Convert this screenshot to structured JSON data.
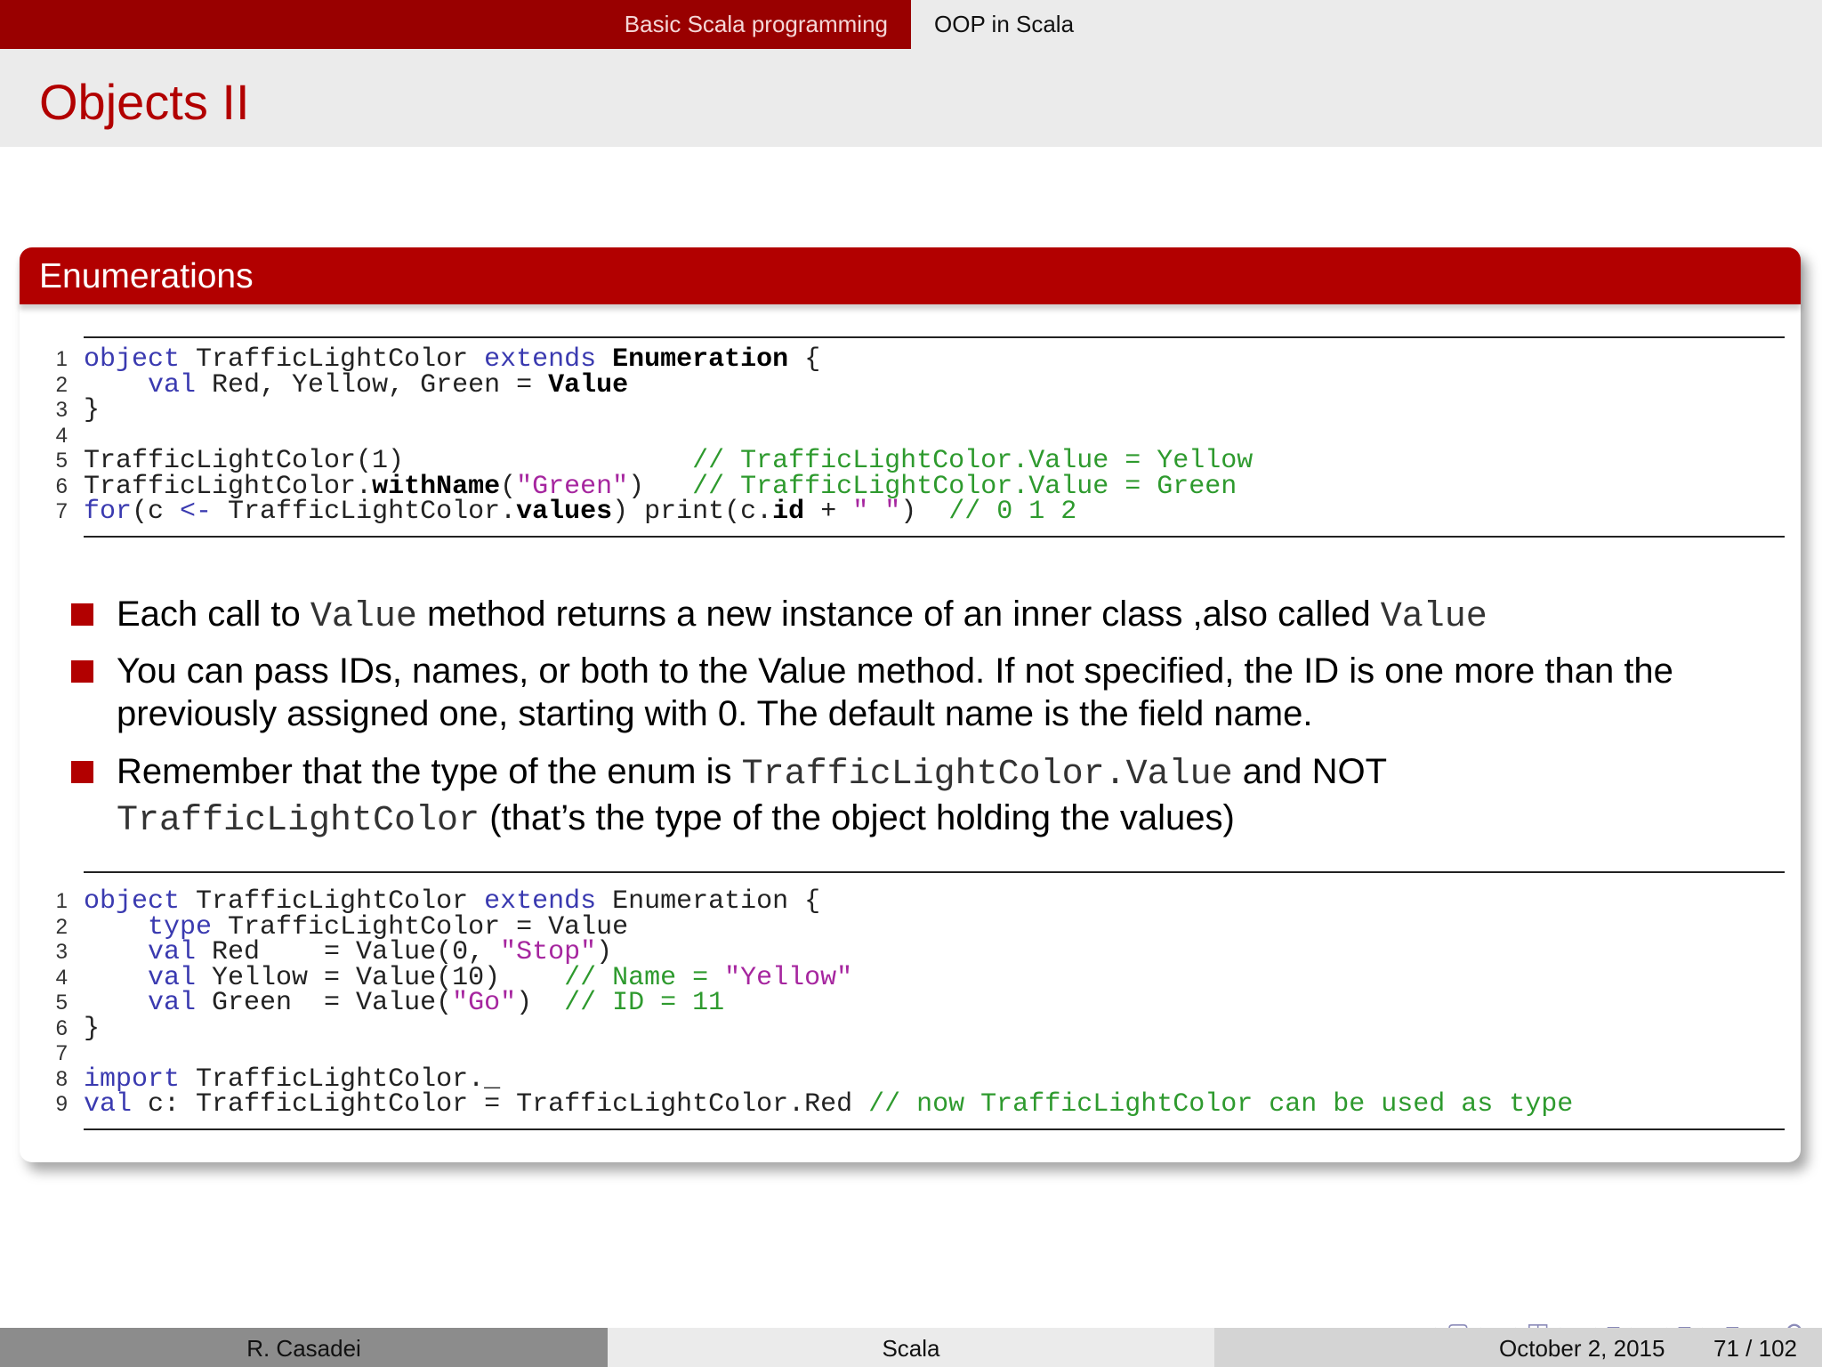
{
  "nav": {
    "section": "Basic Scala programming",
    "subsection": "OOP in Scala"
  },
  "frame_title": "Objects II",
  "block_title": "Enumerations",
  "listing1": [
    {
      "n": "1",
      "parts": [
        [
          "kw",
          "object"
        ],
        [
          "",
          " TrafficLightColor "
        ],
        [
          "kw",
          "extends"
        ],
        [
          "",
          " "
        ],
        [
          "bd",
          "Enumeration"
        ],
        [
          "",
          " {"
        ]
      ]
    },
    {
      "n": "2",
      "parts": [
        [
          "",
          "    "
        ],
        [
          "kw",
          "val"
        ],
        [
          "",
          " Red, Yellow, Green = "
        ],
        [
          "bd",
          "Value"
        ]
      ]
    },
    {
      "n": "3",
      "parts": [
        [
          "",
          "}"
        ]
      ]
    },
    {
      "n": "4",
      "parts": [
        [
          "",
          ""
        ]
      ]
    },
    {
      "n": "5",
      "parts": [
        [
          "",
          "TrafficLightColor(1)                  "
        ],
        [
          "cm",
          "// TrafficLightColor.Value = Yellow"
        ]
      ]
    },
    {
      "n": "6",
      "parts": [
        [
          "",
          "TrafficLightColor."
        ],
        [
          "bd",
          "withName"
        ],
        [
          "",
          "("
        ],
        [
          "st",
          "\"Green\""
        ],
        [
          "",
          ")   "
        ],
        [
          "cm",
          "// TrafficLightColor.Value = Green"
        ]
      ]
    },
    {
      "n": "7",
      "parts": [
        [
          "kw",
          "for"
        ],
        [
          "",
          "(c "
        ],
        [
          "kw",
          "<-"
        ],
        [
          "",
          " TrafficLightColor."
        ],
        [
          "bd",
          "values"
        ],
        [
          "",
          ") print(c."
        ],
        [
          "bd",
          "id"
        ],
        [
          "",
          " + "
        ],
        [
          "st",
          "\" \""
        ],
        [
          "",
          ")  "
        ],
        [
          "cm",
          "// 0 1 2"
        ]
      ]
    }
  ],
  "bullets": [
    [
      [
        "t",
        "Each call to "
      ],
      [
        "c",
        "Value"
      ],
      [
        "t",
        " method returns a new instance of an inner class ,also called "
      ],
      [
        "c",
        "Value"
      ]
    ],
    [
      [
        "t",
        "You can pass IDs, names, or both to the Value method. If not specified, the ID is one more than the"
      ],
      [
        "br",
        ""
      ],
      [
        "t",
        "previously assigned one, starting with 0. The default name is the field name."
      ]
    ],
    [
      [
        "t",
        "Remember that the type of the enum is "
      ],
      [
        "c",
        "TrafficLightColor.Value"
      ],
      [
        "t",
        " and NOT"
      ],
      [
        "br",
        ""
      ],
      [
        "c",
        "TrafficLightColor"
      ],
      [
        "t",
        " (that’s the type of the object holding the values)"
      ]
    ]
  ],
  "listing2": [
    {
      "n": "1",
      "parts": [
        [
          "kw",
          "object"
        ],
        [
          "",
          " TrafficLightColor "
        ],
        [
          "kw",
          "extends"
        ],
        [
          "",
          " Enumeration {"
        ]
      ]
    },
    {
      "n": "2",
      "parts": [
        [
          "",
          "    "
        ],
        [
          "kw",
          "type"
        ],
        [
          "",
          " TrafficLightColor = Value"
        ]
      ]
    },
    {
      "n": "3",
      "parts": [
        [
          "",
          "    "
        ],
        [
          "kw",
          "val"
        ],
        [
          "",
          " Red    = Value(0, "
        ],
        [
          "st",
          "\"Stop\""
        ],
        [
          "",
          ")"
        ]
      ]
    },
    {
      "n": "4",
      "parts": [
        [
          "",
          "    "
        ],
        [
          "kw",
          "val"
        ],
        [
          "",
          " Yellow = Value(10)    "
        ],
        [
          "cm",
          "// Name = "
        ],
        [
          "st",
          "\"Yellow\""
        ]
      ]
    },
    {
      "n": "5",
      "parts": [
        [
          "",
          "    "
        ],
        [
          "kw",
          "val"
        ],
        [
          "",
          " Green  = Value("
        ],
        [
          "st",
          "\"Go\""
        ],
        [
          "",
          ")  "
        ],
        [
          "cm",
          "// ID = 11"
        ]
      ]
    },
    {
      "n": "6",
      "parts": [
        [
          "",
          "}"
        ]
      ]
    },
    {
      "n": "7",
      "parts": [
        [
          "",
          ""
        ]
      ]
    },
    {
      "n": "8",
      "parts": [
        [
          "kw",
          "import"
        ],
        [
          "",
          " TrafficLightColor._"
        ]
      ]
    },
    {
      "n": "9",
      "parts": [
        [
          "kw",
          "val"
        ],
        [
          "",
          " c: TrafficLightColor = TrafficLightColor.Red "
        ],
        [
          "cm",
          "// now TrafficLightColor can be used as type"
        ]
      ]
    }
  ],
  "nav_symbols": "◂ ▢ ▸ ◂ ◰ ▸ ◂ ≡ ▸ ◂ ≡ ▸ ≡ ∽ ⟲",
  "footer": {
    "author": "R. Casadei",
    "short_title": "Scala",
    "date": "October 2, 2015",
    "page": "71 / 102"
  },
  "colors": {
    "accent": "#b20000",
    "dark_accent": "#990000",
    "keyword": "#3a3ab0",
    "comment": "#2e9a2e",
    "string": "#a6269f"
  }
}
